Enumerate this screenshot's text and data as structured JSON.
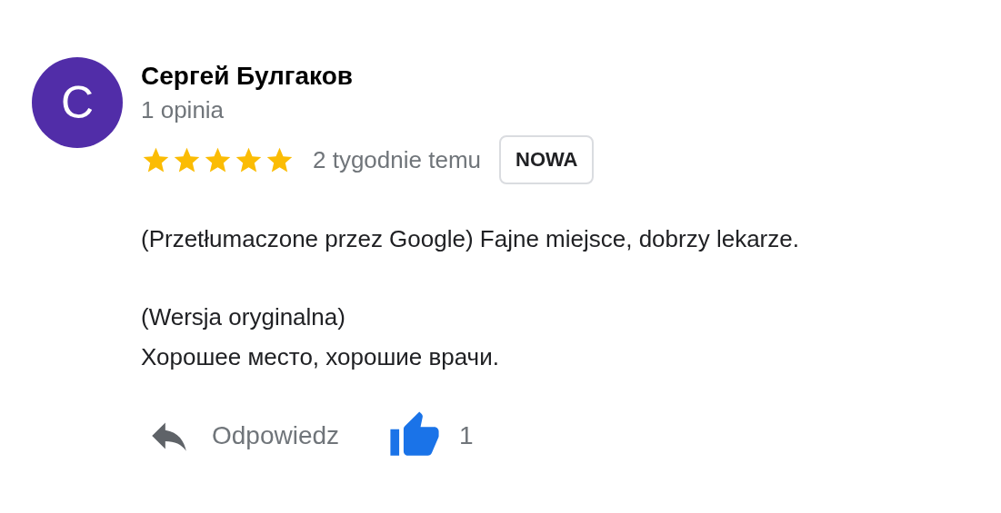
{
  "review": {
    "avatar_letter": "C",
    "author": "Сергей Булгаков",
    "review_count": "1 opinia",
    "stars": 5,
    "time": "2 tygodnie temu",
    "badge": "NOWA",
    "translated": "(Przetłumaczone przez Google) Fajne miejsce, dobrzy lekarze.",
    "original_label": "(Wersja oryginalna)",
    "original_text": "Хорошее место, хорошие врачи.",
    "reply": "Odpowiedz",
    "liked": true,
    "likes": "1"
  }
}
